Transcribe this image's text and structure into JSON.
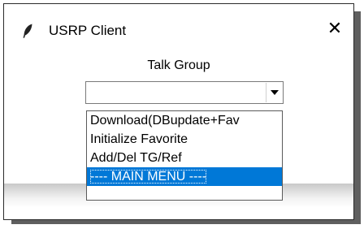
{
  "window": {
    "title": "USRP Client",
    "app_icon": "feather-icon",
    "close_icon": "close-icon",
    "close_glyph": "✕"
  },
  "form": {
    "label": "Talk Group",
    "combo_value": "",
    "dropdown_arrow_icon": "chevron-down-icon"
  },
  "dropdown": {
    "options": [
      {
        "label": "Download(DBupdate+Fav"
      },
      {
        "label": "Initialize Favorite"
      },
      {
        "label": "Add/Del TG/Ref"
      },
      {
        "label": "---- MAIN MENU ----",
        "selected": true
      }
    ]
  },
  "colors": {
    "selection": "#0078d7",
    "shadow": "#5f5f5f"
  }
}
